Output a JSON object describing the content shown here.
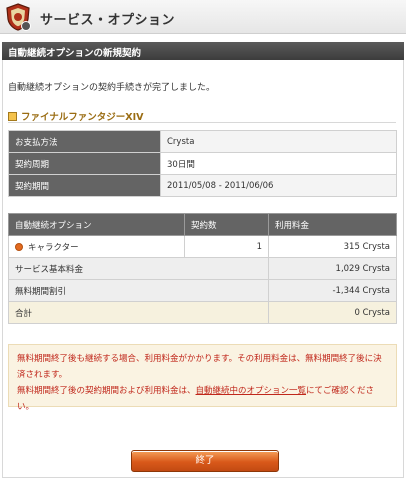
{
  "header": {
    "title": "サービス・オプション"
  },
  "dialog": {
    "title": "自動継続オプションの新規契約"
  },
  "intro_text": "自動継続オプションの契約手続きが完了しました。",
  "game": {
    "title": "ファイナルファンタジーXIV"
  },
  "info": [
    {
      "label": "お支払方法",
      "value": "Crysta"
    },
    {
      "label": "契約周期",
      "value": "30日間"
    },
    {
      "label": "契約期間",
      "value": "2011/05/08 - 2011/06/06"
    }
  ],
  "options": {
    "headers": [
      "自動継続オプション",
      "契約数",
      "利用料金"
    ],
    "rows": [
      {
        "name": "キャラクター",
        "count": "1",
        "fee": "315 Crysta"
      }
    ],
    "base_fee": {
      "label": "サービス基本料金",
      "value": "1,029 Crysta"
    },
    "discount": {
      "label": "無料期間割引",
      "value": "-1,344 Crysta"
    },
    "total": {
      "label": "合計",
      "value": "0 Crysta"
    }
  },
  "notice": {
    "line1": "無料期間終了後も継続する場合、利用料金がかかります。その利用料金は、無料期間終了後に決済されます。",
    "line2_prefix": "無料期間終了後の契約期間および利用料金は、",
    "line2_link": "自動継続中のオプション一覧",
    "line2_suffix": "にてご確認ください。"
  },
  "finish_button": "終了",
  "colors": {
    "accent": "#d9591a",
    "notice_text": "#c0271b",
    "table_header": "#646464"
  }
}
